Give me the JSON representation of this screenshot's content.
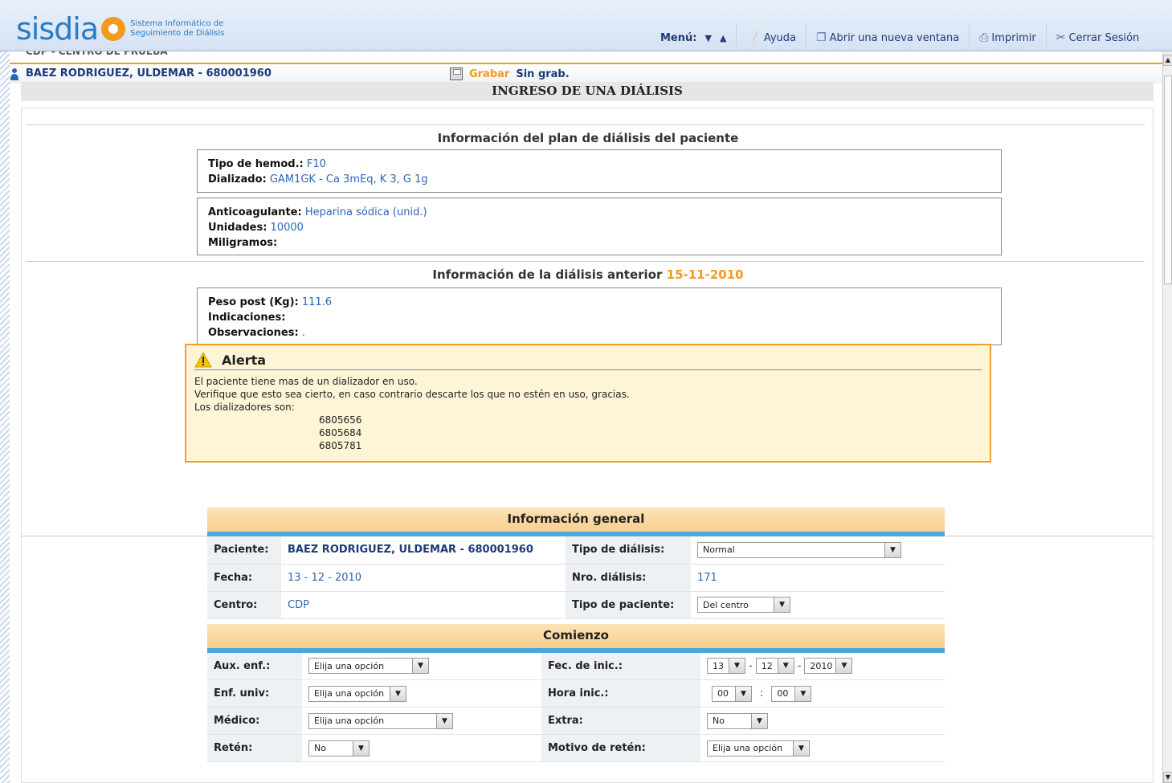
{
  "header": {
    "logo_text": "sisdia",
    "logo_sub_line1": "Sistema Informático de",
    "logo_sub_line2": "Seguimiento de Diálisis",
    "menu_label": "Menú:",
    "help": "Ayuda",
    "new_window": "Abrir una nueva ventana",
    "print": "Imprimir",
    "logout": "Cerrar Sesión"
  },
  "centro_strip": "CDP - CENTRO DE PRUEBA",
  "patient_bar": {
    "name": "BAEZ RODRIGUEZ, ULDEMAR - 680001960",
    "save": "Grabar",
    "unsaved": "Sin grab."
  },
  "page_title": "INGRESO DE UNA DIÁLISIS",
  "plan": {
    "title": "Información del plan de diálisis del paciente",
    "tipo_hemod_label": "Tipo de hemod.:",
    "tipo_hemod": "F10",
    "dializado_label": "Dializado:",
    "dializado": "GAM1GK - Ca 3mEq, K 3, G 1g",
    "anticoag_label": "Anticoagulante:",
    "anticoag": "Heparina sódica (unid.)",
    "unidades_label": "Unidades:",
    "unidades": "10000",
    "miligramos_label": "Miligramos:"
  },
  "previous": {
    "title": "Información de la diálisis anterior",
    "date": "15-11-2010",
    "peso_label": "Peso post (Kg):",
    "peso": "111.6",
    "indicaciones_label": "Indicaciones:",
    "observaciones_label": "Observaciones:",
    "observaciones": "."
  },
  "alert": {
    "title": "Alerta",
    "line1": "El paciente tiene mas de un dializador en uso.",
    "line2": "Verifique que esto sea cierto, en caso contrario descarte los que no estén en uso, gracias.",
    "line3": "Los dializadores son:",
    "dializadores": [
      "6805656",
      "6805684",
      "6805781"
    ]
  },
  "general": {
    "title": "Información general",
    "paciente_label": "Paciente:",
    "paciente": "BAEZ RODRIGUEZ, ULDEMAR - 680001960",
    "tipo_dialisis_label": "Tipo de diálisis:",
    "tipo_dialisis": "Normal",
    "fecha_label": "Fecha:",
    "fecha": "13 - 12 - 2010",
    "nro_dialisis_label": "Nro. diálisis:",
    "nro_dialisis": "171",
    "centro_label": "Centro:",
    "centro": "CDP",
    "tipo_paciente_label": "Tipo de paciente:",
    "tipo_paciente": "Del centro"
  },
  "comienzo": {
    "title": "Comienzo",
    "aux_label": "Aux. enf.:",
    "aux": "Elija una opción",
    "fec_label": "Fec. de inic.:",
    "fec_day": "13",
    "fec_month": "12",
    "fec_year": "2010",
    "enf_label": "Enf. univ:",
    "enf": "Elija una opción",
    "hora_label": "Hora inic.:",
    "hora_h": "00",
    "hora_m": "00",
    "medico_label": "Médico:",
    "medico": "Elija una opción",
    "extra_label": "Extra:",
    "extra": "No",
    "reten_label": "Retén:",
    "reten": "No",
    "motivo_label": "Motivo de retén:",
    "motivo": "Elija una opción"
  }
}
